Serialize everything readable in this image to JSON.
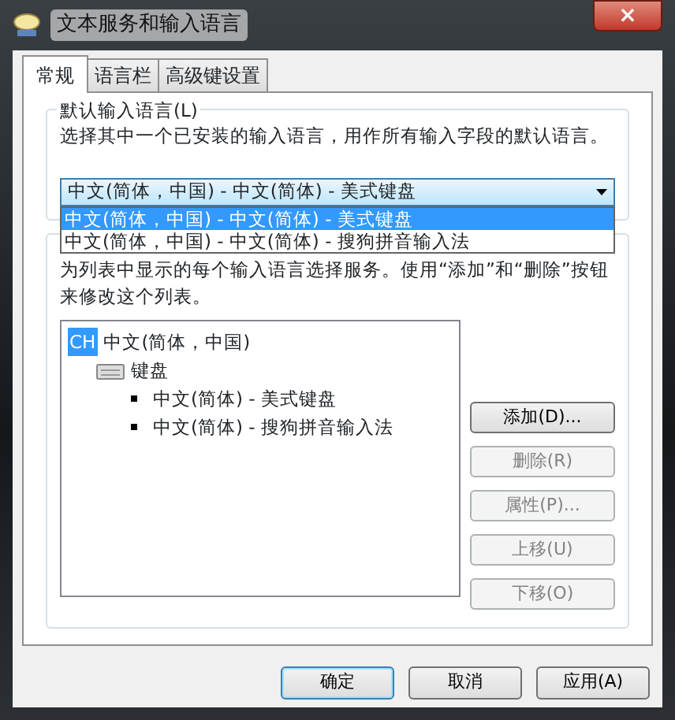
{
  "window": {
    "title": "文本服务和输入语言",
    "close": "×"
  },
  "tabs": [
    {
      "label": "常规",
      "selected": true
    },
    {
      "label": "语言栏",
      "selected": false
    },
    {
      "label": "高级键设置",
      "selected": false
    }
  ],
  "default_language": {
    "legend": "默认输入语言(L)",
    "description": "选择其中一个已安装的输入语言，用作所有输入字段的默认语言。",
    "value": "中文(简体，中国) - 中文(简体) - 美式键盘",
    "expanded": true,
    "options": [
      {
        "label": "中文(简体，中国) - 中文(简体) - 美式键盘",
        "selected": true
      },
      {
        "label": "中文(简体，中国) - 中文(简体) - 搜狗拼音输入法",
        "selected": false
      }
    ]
  },
  "services": {
    "description": "为列表中显示的每个输入语言选择服务。使用“添加”和“删除”按钮来修改这个列表。",
    "tree": [
      {
        "badge": "CH",
        "label": "中文(简体，中国)",
        "children": [
          {
            "label": "键盘",
            "children": [
              {
                "label": "中文(简体) - 美式键盘"
              },
              {
                "label": "中文(简体) - 搜狗拼音输入法"
              }
            ]
          }
        ]
      }
    ],
    "buttons": [
      {
        "label": "添加(D)...",
        "disabled": false
      },
      {
        "label": "删除(R)",
        "disabled": true
      },
      {
        "label": "属性(P)...",
        "disabled": true
      },
      {
        "label": "上移(U)",
        "disabled": true
      },
      {
        "label": "下移(O)",
        "disabled": true
      }
    ]
  },
  "footer_buttons": [
    {
      "label": "确定",
      "selected": true
    },
    {
      "label": "取消",
      "selected": false
    },
    {
      "label": "应用(A)",
      "selected": false
    }
  ]
}
